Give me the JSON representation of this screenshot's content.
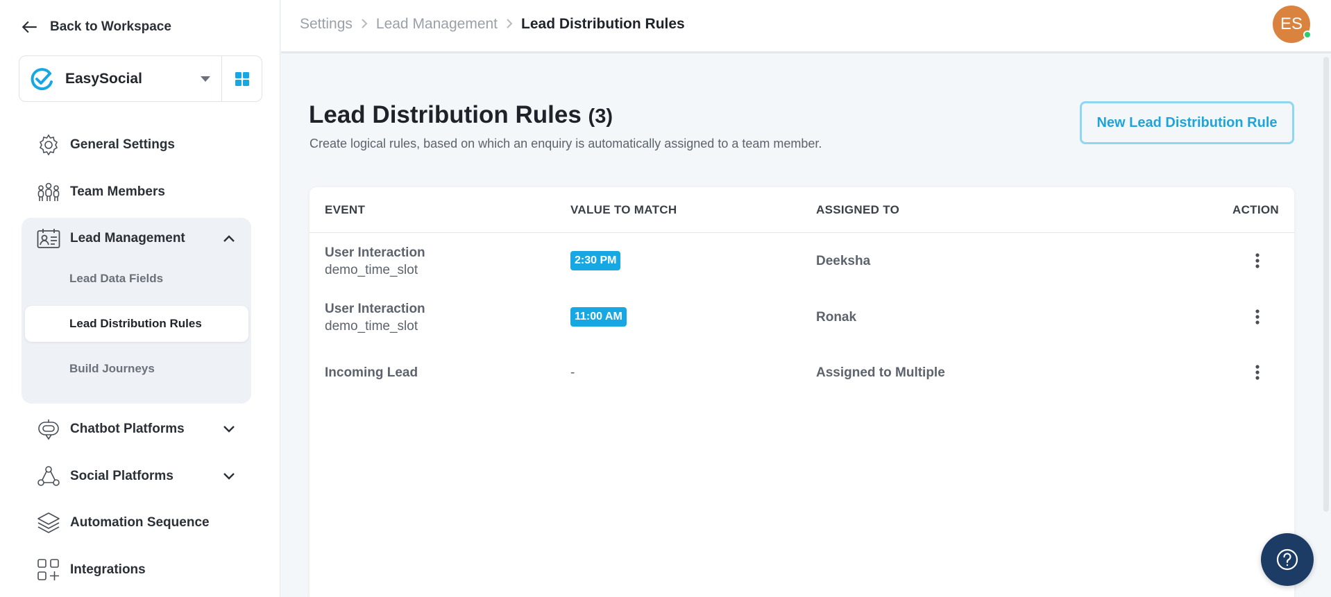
{
  "sidebar": {
    "back_label": "Back to Workspace",
    "workspace_name": "EasySocial",
    "nav": [
      {
        "label": "General Settings"
      },
      {
        "label": "Team Members"
      },
      {
        "label": "Lead Management"
      },
      {
        "label": "Chatbot Platforms"
      },
      {
        "label": "Social Platforms"
      },
      {
        "label": "Automation Sequence"
      },
      {
        "label": "Integrations"
      }
    ],
    "lead_sub": [
      {
        "label": "Lead Data Fields"
      },
      {
        "label": "Lead Distribution Rules"
      },
      {
        "label": "Build Journeys"
      }
    ]
  },
  "breadcrumb": [
    "Settings",
    "Lead Management",
    "Lead Distribution Rules"
  ],
  "user": {
    "initials": "ES",
    "status_color": "#2ecc71"
  },
  "page": {
    "title": "Lead Distribution Rules",
    "count": "(3)",
    "subtitle": "Create logical rules, based on which an enquiry is automatically assigned to a team member.",
    "new_button": "New Lead Distribution Rule"
  },
  "table": {
    "headers": [
      "EVENT",
      "VALUE TO MATCH",
      "ASSIGNED TO",
      "ACTION"
    ],
    "rows": [
      {
        "event": "User Interaction",
        "event_sub": "demo_time_slot",
        "value": "2:30 PM",
        "assigned": "Deeksha"
      },
      {
        "event": "User Interaction",
        "event_sub": "demo_time_slot",
        "value": "11:00 AM",
        "assigned": "Ronak"
      },
      {
        "event": "Incoming Lead",
        "event_sub": "",
        "value": "-",
        "assigned": "Assigned to Multiple"
      }
    ]
  },
  "colors": {
    "accent": "#17a8e3",
    "help_button": "#1c3c66",
    "avatar": "#d9833f"
  }
}
